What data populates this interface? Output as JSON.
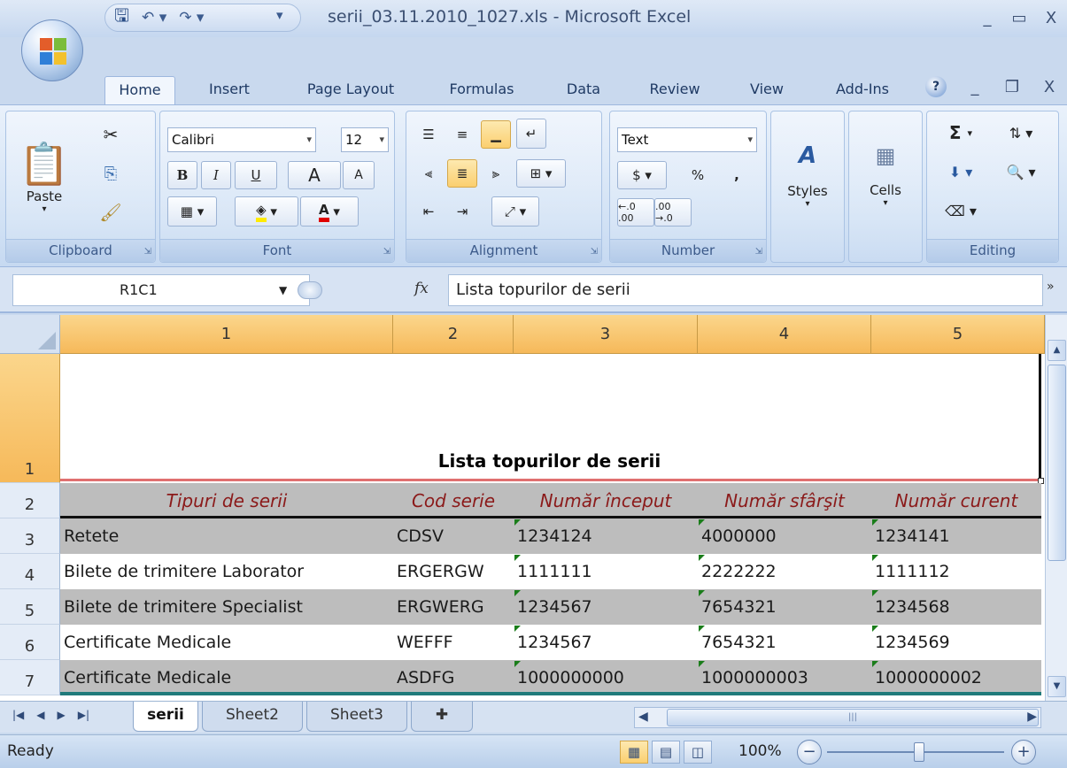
{
  "window": {
    "title": "serii_03.11.2010_1027.xls - Microsoft Excel",
    "controls": [
      "_",
      "▭",
      "X"
    ]
  },
  "ribbon": {
    "tabs": [
      "Home",
      "Insert",
      "Page Layout",
      "Formulas",
      "Data",
      "Review",
      "View",
      "Add-Ins"
    ],
    "active_tab": "Home",
    "clipboard": {
      "label": "Clipboard",
      "paste": "Paste"
    },
    "font": {
      "label": "Font",
      "name": "Calibri",
      "size": "12",
      "bold": "B",
      "italic": "I",
      "underline": "U",
      "grow": "A",
      "shrink": "A"
    },
    "alignment": {
      "label": "Alignment"
    },
    "number": {
      "label": "Number",
      "format": "Text",
      "currency": "$",
      "percent": "%",
      "comma": ",",
      "inc_decimal": "←.0 .00",
      "dec_decimal": ".00 →.0"
    },
    "styles": {
      "label": "Styles"
    },
    "cells": {
      "label": "Cells"
    },
    "editing": {
      "label": "Editing",
      "sum": "Σ"
    }
  },
  "formula_bar": {
    "name_box": "R1C1",
    "fx": "fx",
    "content": "Lista topurilor de serii"
  },
  "grid": {
    "column_headers": [
      "1",
      "2",
      "3",
      "4",
      "5"
    ],
    "row_headers": [
      "1",
      "2",
      "3",
      "4",
      "5",
      "6",
      "7"
    ],
    "title": "Lista topurilor de serii",
    "headers": [
      "Tipuri de serii",
      "Cod serie",
      "Număr început",
      "Număr sfârşit",
      "Număr curent"
    ],
    "rows": [
      [
        "Retete",
        "CDSV",
        "1234124",
        "4000000",
        "1234141"
      ],
      [
        "Bilete de trimitere Laborator",
        "ERGERGW",
        "1111111",
        "2222222",
        "1111112"
      ],
      [
        "Bilete de trimitere Specialist",
        "ERGWERG",
        "1234567",
        "7654321",
        "1234568"
      ],
      [
        "Certificate Medicale",
        "WEFFF",
        "1234567",
        "7654321",
        "1234569"
      ],
      [
        "Certificate Medicale",
        "ASDFG",
        "1000000000",
        "1000000003",
        "1000000002"
      ]
    ]
  },
  "sheets": [
    "serii",
    "Sheet2",
    "Sheet3"
  ],
  "active_sheet": "serii",
  "status": {
    "text": "Ready",
    "zoom": "100%"
  }
}
